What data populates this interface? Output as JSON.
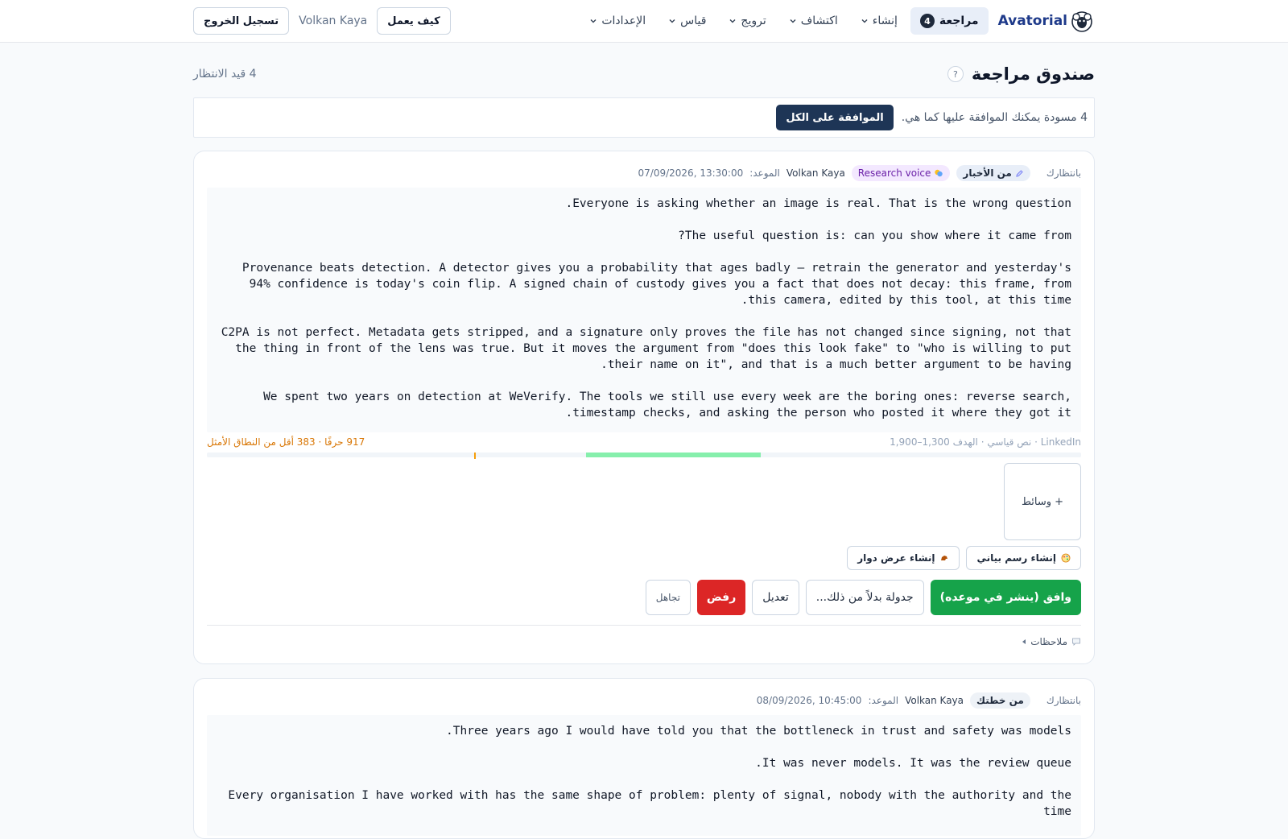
{
  "nav": {
    "logo_text": "Avatorial",
    "review_label": "مراجعة",
    "review_count": "4",
    "menus": [
      "إنشاء",
      "اكتشاف",
      "ترويج",
      "قياس",
      "الإعدادات"
    ],
    "how_it_works": "كيف يعمل",
    "user_name": "Volkan Kaya",
    "logout": "تسجيل الخروج"
  },
  "header": {
    "title": "صندوق مراجعة",
    "help": "?",
    "pending": "4 قيد الانتظار"
  },
  "bulk": {
    "text": "4 مسودة يمكنك الموافقة عليها كما هي.",
    "approve_all": "الموافقة على الكل"
  },
  "cards": [
    {
      "status": "بانتظارك",
      "source_pill": "من الأخبار",
      "voice_pill": "Research voice",
      "author": "Volkan Kaya",
      "due_label": "الموعد:",
      "due_value": "07/09/2026, 13:30:00",
      "paragraphs": [
        "Everyone is asking whether an image is real. That is the wrong question.",
        "The useful question is: can you show where it came from?",
        "Provenance beats detection. A detector gives you a probability that ages badly — retrain the generator and yesterday's 94% confidence is today's coin flip. A signed chain of custody gives you a fact that does not decay: this frame, from this camera, edited by this tool, at this time.",
        "C2PA is not perfect. Metadata gets stripped, and a signature only proves the file has not changed since signing, not that the thing in front of the lens was true. But it moves the argument from \"does this look fake\" to \"who is willing to put their name on it\", and that is a much better argument to be having.",
        "We spent two years on detection at WeVerify. The tools we still use every week are the boring ones: reverse search, timestamp checks, and asking the person who posted it where they got it."
      ],
      "count_info": "LinkedIn · نص قياسي · الهدف 1,300–1,900",
      "count_warn": "917 حرفًا · 383 أقل من النطاق الأمثل",
      "count_value": 917,
      "target_min": 1300,
      "target_max": 1900,
      "media": "+ وسائط",
      "gen_chart": "إنشاء رسم بياني",
      "gen_carousel": "إنشاء عرض دوار",
      "approve": "وافق (ينشر في موعده)",
      "reschedule": "جدولة بدلاً من ذلك...",
      "edit": "تعديل",
      "reject": "رفض",
      "ignore": "تجاهل",
      "notes": "ملاحظات"
    },
    {
      "status": "بانتظارك",
      "source_pill": "من خطتك",
      "author": "Volkan Kaya",
      "due_label": "الموعد:",
      "due_value": "08/09/2026, 10:45:00",
      "paragraphs": [
        "Three years ago I would have told you that the bottleneck in trust and safety was models.",
        "It was never models. It was the review queue.",
        "Every organisation I have worked with has the same shape of problem: plenty of signal, nobody with the authority and the time"
      ]
    }
  ],
  "colors": {
    "brand": "#1e3a8a",
    "approve": "#16a34a",
    "reject": "#dc2626",
    "dark_button": "#1e3556",
    "warn": "#d97706",
    "optimal_range": "#86efac"
  }
}
